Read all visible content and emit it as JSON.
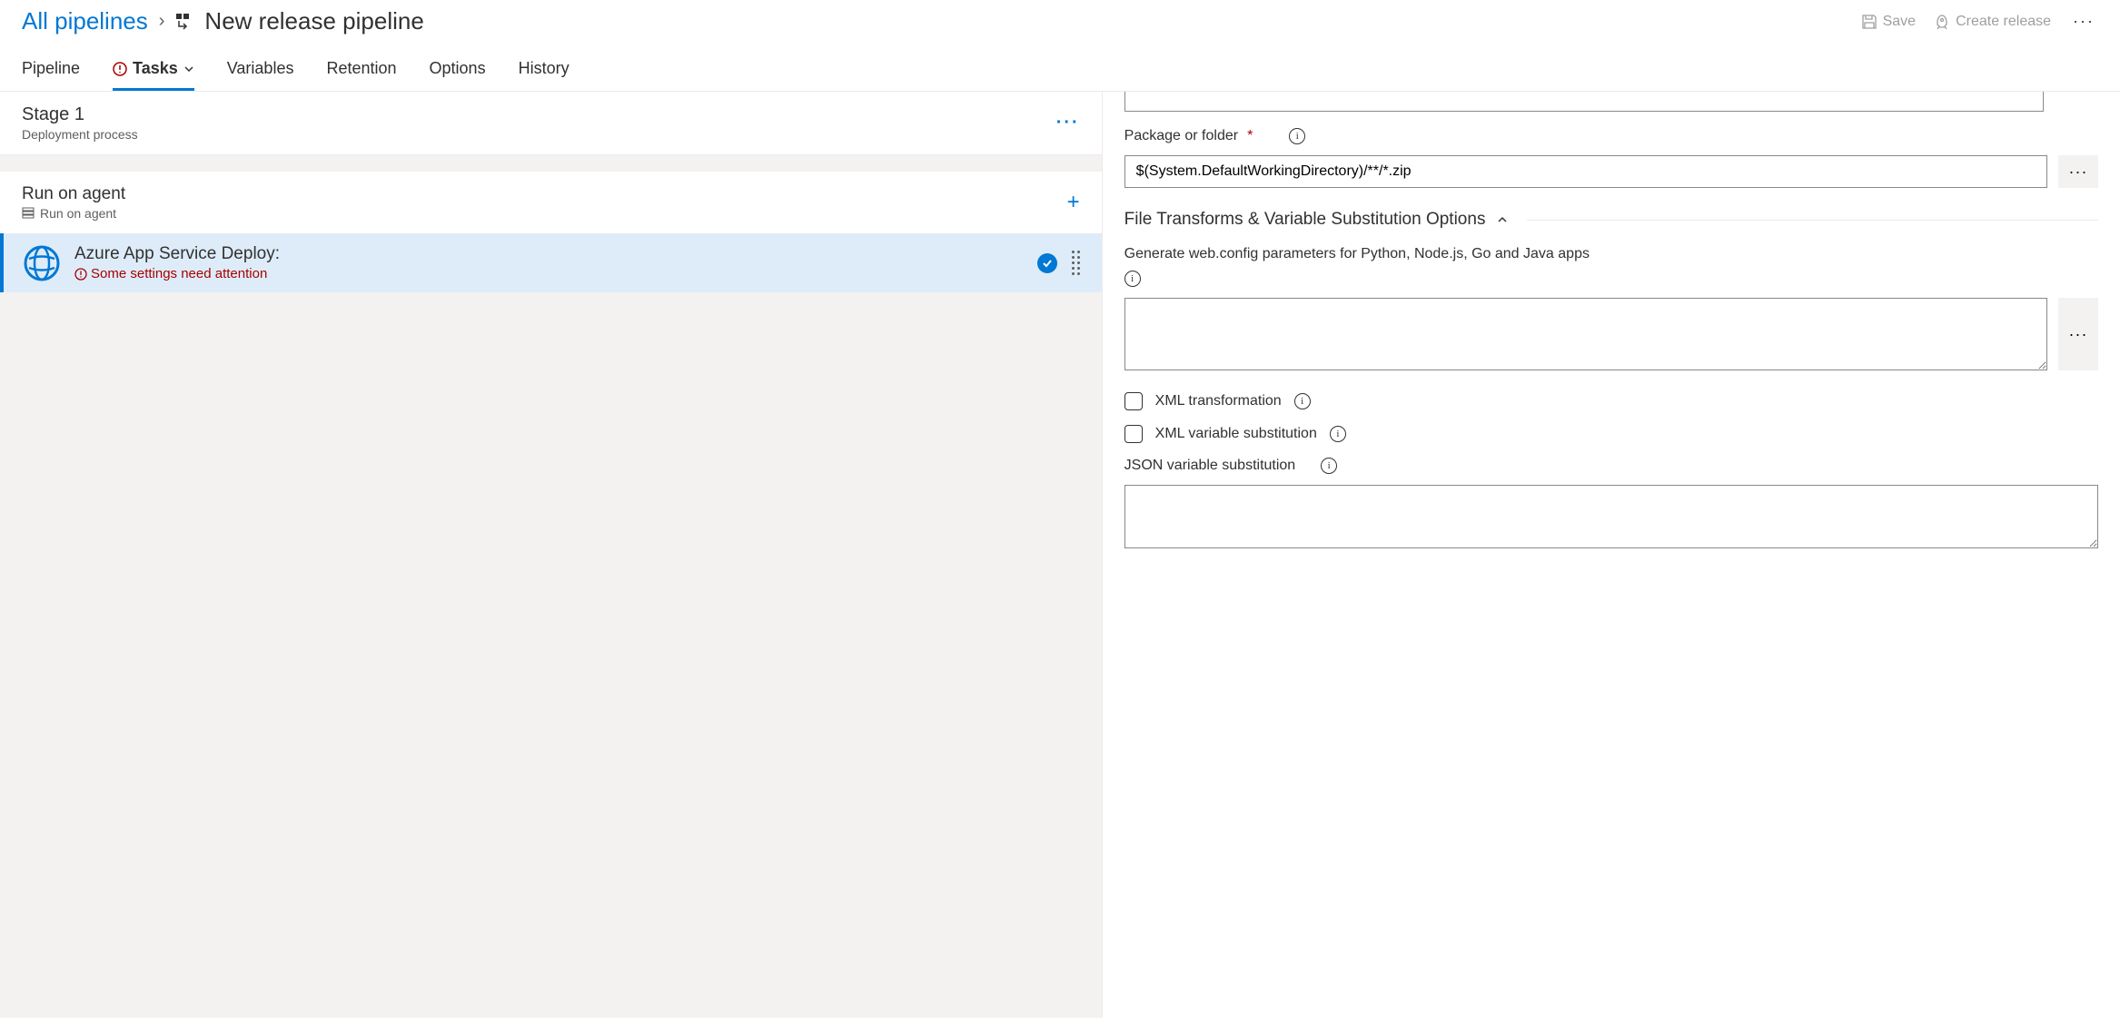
{
  "breadcrumb": {
    "parent": "All pipelines",
    "current": "New release pipeline"
  },
  "header_actions": {
    "save": "Save",
    "create_release": "Create release"
  },
  "tabs": {
    "pipeline": "Pipeline",
    "tasks": "Tasks",
    "variables": "Variables",
    "retention": "Retention",
    "options": "Options",
    "history": "History"
  },
  "stage": {
    "title": "Stage 1",
    "subtitle": "Deployment process"
  },
  "agent": {
    "title": "Run on agent",
    "subtitle": "Run on agent"
  },
  "task": {
    "title": "Azure App Service Deploy:",
    "error": "Some settings need attention"
  },
  "form": {
    "package_label": "Package or folder",
    "package_value": "$(System.DefaultWorkingDirectory)/**/*.zip",
    "transforms_header": "File Transforms & Variable Substitution Options",
    "webconfig_label": "Generate web.config parameters for Python, Node.js, Go and Java apps",
    "webconfig_value": "",
    "xml_transform": "XML transformation",
    "xml_var_sub": "XML variable substitution",
    "json_var_sub": "JSON variable substitution",
    "json_value": ""
  }
}
